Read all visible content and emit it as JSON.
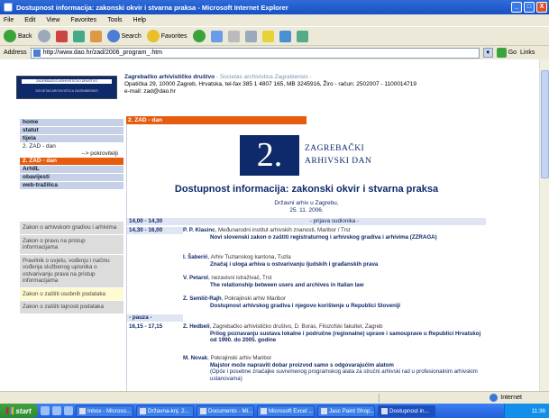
{
  "window": {
    "title": "Dostupnost informacija: zakonski okvir i stvarna praksa - Microsoft Internet Explorer",
    "controls": [
      "_",
      "□",
      "X"
    ]
  },
  "menubar": {
    "items": [
      "File",
      "Edit",
      "View",
      "Favorites",
      "Tools",
      "Help"
    ]
  },
  "toolbar": {
    "back": "Back",
    "search": "Search",
    "favorites": "Favorites"
  },
  "addressbar": {
    "label": "Address",
    "url": "http://www.dao.hr/zad/2006_program_.htm",
    "go": "Go",
    "links": "Links"
  },
  "header": {
    "logo_line1": "ZAGREBAČKO ARHIVISTIČKO DRUŠTVO",
    "logo_line2": "SOCIETAS ARCHIVISTICA ZAGRABIENSIS",
    "org_name": "Zagrebačko arhivističko društvo",
    "org_name_latin": "- Societas archivistica Zagrabiensis -",
    "address": "Opatička 29, 10000 Zagreb, Hrvatska, tel-fax 385 1 4807 165, MB 3245916, Žiro - račun: 2502007 - 1100014719",
    "email": "e-mail: zad@dao.hr"
  },
  "sidebar": {
    "items": [
      "home",
      "statut",
      "tijela"
    ],
    "zad_plain": "2. ZAD - dan",
    "pokrovitelji": "--> pokrovitelji",
    "zad_active": "2. ZAD - dan",
    "items2": [
      "ArhIIL",
      "obavijesti",
      "web-tražilica"
    ],
    "links": [
      "Zakon o arhivskom gradivu i arhivima",
      "Zakon o pravu na pristup informacijama",
      "Pravilnik o uvjetu, vođenju i načinu vođenja službenog upisnika o ostvarivanju prava na pristup informacijama",
      "Zakon o zaštiti osobnih podataka",
      "Zakon o zaštiti tajnosti podataka"
    ]
  },
  "main": {
    "section_label": "2. ZAD - dan",
    "banner_number": "2.",
    "banner_line1": "ZAGREBAČKI",
    "banner_line2": "ARHIVSKI DAN",
    "title": "Dostupnost informacija: zakonski okvir i stvarna praksa",
    "venue": "Državni arhiv u Zagrebu,",
    "date": "25. 11. 2006.",
    "program": [
      {
        "time": "14,00 - 14,30",
        "band": "- prijava sudionika -"
      },
      {
        "time": "14,30 - 16,00"
      }
    ],
    "talks": [
      {
        "speaker": "P. P. Klasinc",
        "rest": ", Međunarodni institut arhivskih znanosti, Maribor / Trst",
        "title": "Novi slovenski zakon o zaštiti registraturnog i arhivskog gradiva i arhivima (ZZRAGA)"
      },
      {
        "speaker": "I. Šaberić",
        "rest": ", Arhiv Tuzlanskog kantona, Tuzla",
        "title": "Značaj i uloga arhiva u ostvarivanju ljudskih i građanskih prava"
      },
      {
        "speaker": "V. Petarol",
        "rest": ", nezavisni istraživač, Trst",
        "title": "The relationship between users and archives in Italian law"
      },
      {
        "speaker": "Z. Semlič-Rajh",
        "rest": ", Pokrajinski arhiv Maribor",
        "title": "Dostupnost arhivskog gradiva i njegovo korištenje u Republici Sloveniji"
      }
    ],
    "pause_label": "- pauza -",
    "time2": "16,15 - 17,15",
    "talks2": [
      {
        "speaker": "Z. Hedbeli",
        "rest": ", Zagrebačko arhivističko društvo, D. Boras, Filozofski fakultet, Zagreb",
        "title": "Prilog poznavanju sustava lokalne i područne (regionalne) uprave i samouprave u Republici Hrvatskoj od 1990. do 2005. godine"
      },
      {
        "speaker": "M. Novak",
        "rest": ", Pokrajinski arhiv Maribor",
        "title": "Majstor može napraviti dobar proizvod samo s odgovarajućim alatom",
        "note": "(Opće i posebne značajke suvremenog programskog alata za stručni arhivski rad u profesionalnim arhivskim ustanovama)"
      }
    ]
  },
  "statusbar": {
    "zone": "Internet"
  },
  "taskbar": {
    "start": "start",
    "tasks": [
      "Inbox - Microso...",
      "Državna-knj. 2...",
      "Documents - Mi...",
      "Microsoft Excel ...",
      "Jasc Paint Shop...",
      "Dostupnost in..."
    ],
    "clock": "11:36"
  }
}
